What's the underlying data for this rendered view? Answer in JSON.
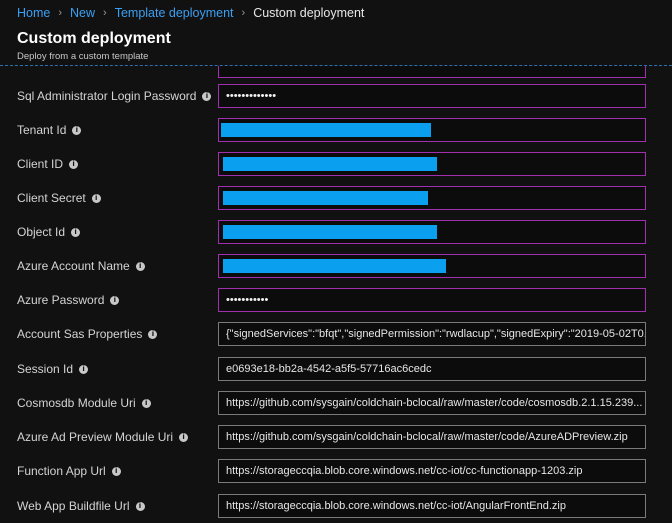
{
  "breadcrumb": {
    "items": [
      "Home",
      "New",
      "Template deployment"
    ],
    "current": "Custom deployment"
  },
  "header": {
    "title": "Custom deployment",
    "subtitle": "Deploy from a custom template"
  },
  "fields": [
    {
      "label": "Sql Administrator Login Password",
      "value": "•••••••••••••",
      "kind": "password",
      "state": "invalid"
    },
    {
      "label": "Tenant Id",
      "value": "",
      "kind": "redacted",
      "state": "invalid",
      "redact_fraction": 0.49
    },
    {
      "label": "Client ID",
      "value": "",
      "kind": "redacted",
      "state": "invalid",
      "redact_fraction": 0.5
    },
    {
      "label": "Client Secret",
      "value": "",
      "kind": "redacted",
      "state": "invalid",
      "redact_fraction": 0.48
    },
    {
      "label": "Object Id",
      "value": "",
      "kind": "redacted",
      "state": "invalid",
      "redact_fraction": 0.5
    },
    {
      "label": "Azure Account Name",
      "value": "",
      "kind": "redacted",
      "state": "invalid",
      "redact_fraction": 0.52
    },
    {
      "label": "Azure Password",
      "value": "•••••••••••",
      "kind": "password",
      "state": "invalid"
    },
    {
      "label": "Account Sas Properties",
      "value": "{\"signedServices\":\"bfqt\",\"signedPermission\":\"rwdlacup\",\"signedExpiry\":\"2019-05-02T0...",
      "kind": "text",
      "state": "normal"
    },
    {
      "label": "Session Id",
      "value": "e0693e18-bb2a-4542-a5f5-57716ac6cedc",
      "kind": "text",
      "state": "normal"
    },
    {
      "label": "Cosmosdb Module Uri",
      "value": "https://github.com/sysgain/coldchain-bclocal/raw/master/code/cosmosdb.2.1.15.239...",
      "kind": "text",
      "state": "normal"
    },
    {
      "label": "Azure Ad Preview Module Uri",
      "value": "https://github.com/sysgain/coldchain-bclocal/raw/master/code/AzureADPreview.zip",
      "kind": "text",
      "state": "normal"
    },
    {
      "label": "Function App Url",
      "value": "https://storageccqia.blob.core.windows.net/cc-iot/cc-functionapp-1203.zip",
      "kind": "text",
      "state": "normal"
    },
    {
      "label": "Web App Buildfile Url",
      "value": "https://storageccqia.blob.core.windows.net/cc-iot/AngularFrontEnd.zip",
      "kind": "text",
      "state": "normal"
    }
  ],
  "colors": {
    "background": "#111111",
    "link": "#3aa0f3",
    "invalid_border": "#a12fb0",
    "normal_border": "#7a7a7a",
    "redaction": "#0b9ff0"
  },
  "icons": {
    "info": "info-icon"
  }
}
